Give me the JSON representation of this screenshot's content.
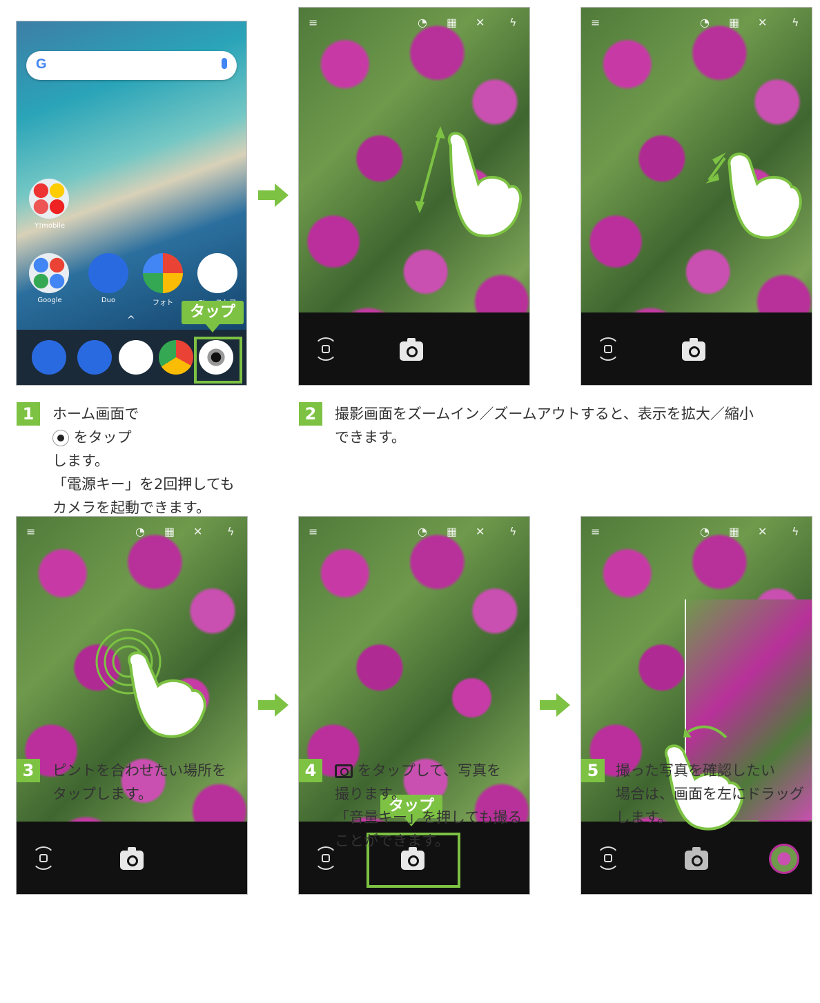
{
  "colors": {
    "accent": "#7dc243",
    "dark": "#111111"
  },
  "home": {
    "search_icon": "google-g-icon",
    "apps": [
      {
        "label": "Y!mobile"
      },
      {
        "label": "Google"
      },
      {
        "label": "Duo"
      },
      {
        "label": "フォト"
      },
      {
        "label": "Play ストア"
      }
    ],
    "tap_label": "タップ"
  },
  "shutter_tap_label": "タップ",
  "steps": [
    {
      "num": "1",
      "lines": [
        "ホーム画面で",
        "をタップ",
        "します。",
        "「電源キー」を2回押しても",
        "カメラを起動できます。"
      ]
    },
    {
      "num": "2",
      "lines": [
        "撮影画面をズームイン／ズームアウトすると、表示を拡大／縮小",
        "できます。"
      ]
    },
    {
      "num": "3",
      "lines": [
        "ピントを合わせたい場所を",
        "タップします。"
      ]
    },
    {
      "num": "4",
      "lines": [
        "をタップして、写真を",
        "撮ります。",
        "「音量キー」を押しても撮る",
        "ことができます。"
      ]
    },
    {
      "num": "5",
      "lines": [
        "撮った写真を確認したい",
        "場合は、画面を左にドラッグ",
        "します。"
      ]
    }
  ]
}
